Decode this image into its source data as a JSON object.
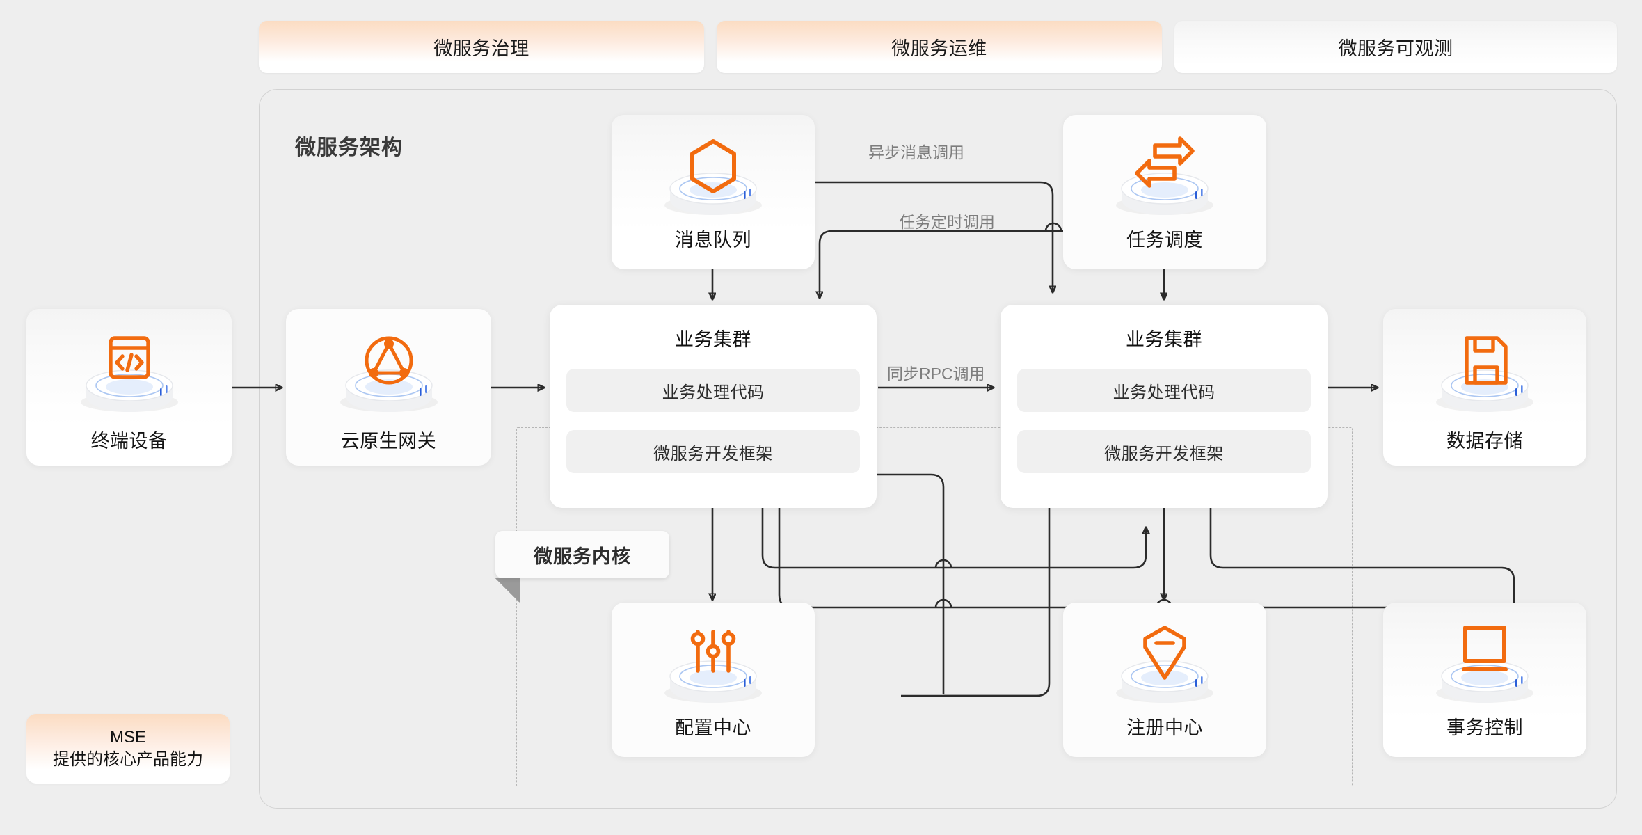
{
  "top_tabs": [
    {
      "label": "微服务治理",
      "style": "accent"
    },
    {
      "label": "微服务运维",
      "style": "accent"
    },
    {
      "label": "微服务可观测",
      "style": "plain"
    }
  ],
  "arch": {
    "title": "微服务架构",
    "kernel_tag": "微服务内核"
  },
  "nodes": {
    "terminal": {
      "label": "终端设备",
      "icon": "code-window-icon",
      "style": "plain"
    },
    "gateway": {
      "label": "云原生网关",
      "icon": "gateway-triangle-icon",
      "style": "accent"
    },
    "mq": {
      "label": "消息队列",
      "icon": "hexagon-icon",
      "style": "plain"
    },
    "scheduler": {
      "label": "任务调度",
      "icon": "swap-arrows-icon",
      "style": "accent"
    },
    "storage": {
      "label": "数据存储",
      "icon": "floppy-disk-icon",
      "style": "plain"
    },
    "config": {
      "label": "配置中心",
      "icon": "sliders-icon",
      "style": "accent"
    },
    "registry": {
      "label": "注册中心",
      "icon": "gem-minus-icon",
      "style": "accent"
    },
    "transaction": {
      "label": "事务控制",
      "icon": "laptop-icon",
      "style": "plain"
    }
  },
  "clusters": {
    "left": {
      "title": "业务集群",
      "row1": "业务处理代码",
      "row2": "微服务开发框架"
    },
    "right": {
      "title": "业务集群",
      "row1": "业务处理代码",
      "row2": "微服务开发框架"
    }
  },
  "edge_labels": {
    "async_msg": "异步消息调用",
    "scheduled_task": "任务定时调用",
    "sync_rpc": "同步RPC调用"
  },
  "legend": {
    "title": "MSE",
    "subtitle": "提供的核心产品能力"
  },
  "colors": {
    "accent_orange": "#F26B0F",
    "background": "#eeeeee",
    "wire": "#2b2b2b",
    "label_gray": "#7d7d7d"
  }
}
